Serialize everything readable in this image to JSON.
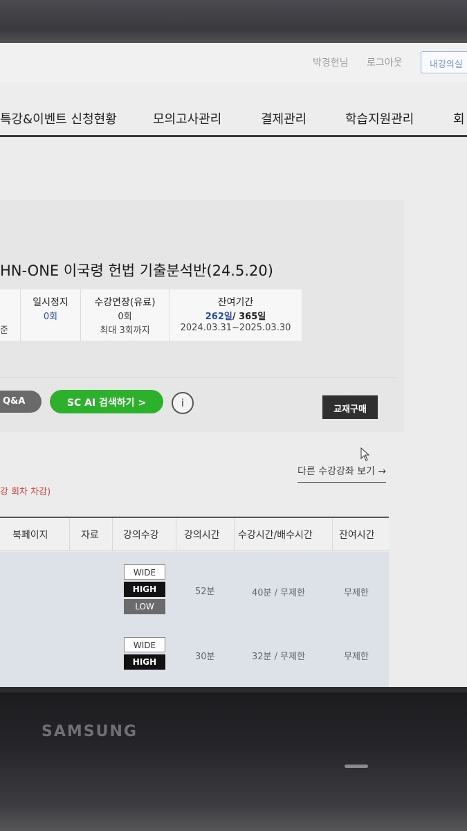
{
  "header": {
    "user": "박경현님",
    "logout": "로그아웃",
    "my_room": "내강의실"
  },
  "gnb": {
    "items": [
      "특강&이벤트 신청현황",
      "모의고사관리",
      "결제관리",
      "학습지원관리",
      "회"
    ]
  },
  "course": {
    "title": "HN-ONE 이국령 헌법 기출분석반(24.5.20)",
    "cut_label": "준",
    "pause": {
      "header": "일시정지",
      "value": "0회"
    },
    "extend": {
      "header": "수강연장(유료)",
      "value": "0회",
      "note": "최대 3회까지"
    },
    "remaining": {
      "header": "잔여기간",
      "days": "262일",
      "total": "/ 365일",
      "period": "2024.03.31~2025.03.30"
    }
  },
  "buttons": {
    "qa": "Q&A",
    "ai_search": "SC AI 검색하기 >",
    "info": "i",
    "buy_book": "교재구매"
  },
  "other_courses_link": "다른 수강강좌 보기 →",
  "note": "강 회차 차감)",
  "lecture_table": {
    "headers": [
      "북페이지",
      "자료",
      "강의수강",
      "강의시간",
      "수강시간/배수시간",
      "잔여시간"
    ],
    "rows": [
      {
        "qualities": [
          "WIDE",
          "HIGH",
          "LOW"
        ],
        "lecture_time": "52분",
        "study_time": "40분 / 무제한",
        "remain": "무제한"
      },
      {
        "qualities": [
          "WIDE",
          "HIGH"
        ],
        "lecture_time": "30분",
        "study_time": "32분 / 무제한",
        "remain": "무제한"
      }
    ]
  },
  "device": {
    "brand": "SAMSUNG"
  },
  "taskbar": {
    "icons": [
      "widgets-icon",
      "edge-icon",
      "file-explorer-icon",
      "store-icon",
      "settings-icon",
      "search-app-icon",
      "text-app-icon",
      "youtube-icon",
      "kakao-icon",
      "chrome-icon"
    ],
    "tray": [
      "chevron-up-icon",
      "cloud-icon",
      "sync-icon"
    ]
  },
  "colors": {
    "accent_green": "#2db12d",
    "link_blue": "#2a4da8",
    "note_red": "#e04040"
  }
}
